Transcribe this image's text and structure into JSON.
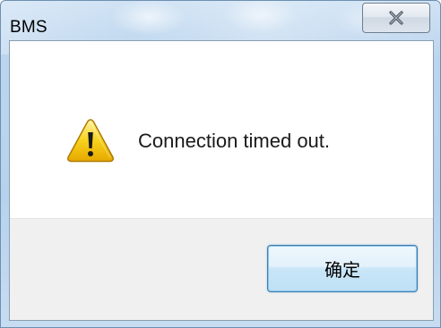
{
  "window": {
    "title": "BMS"
  },
  "icons": {
    "close": "close-icon",
    "warning": "warning-icon"
  },
  "dialog": {
    "message": "Connection timed out.",
    "ok_label": "确定"
  },
  "colors": {
    "titlebar": "#bcd5ee",
    "button_border": "#3c7fb1",
    "warning_fill": "#f5c400"
  }
}
